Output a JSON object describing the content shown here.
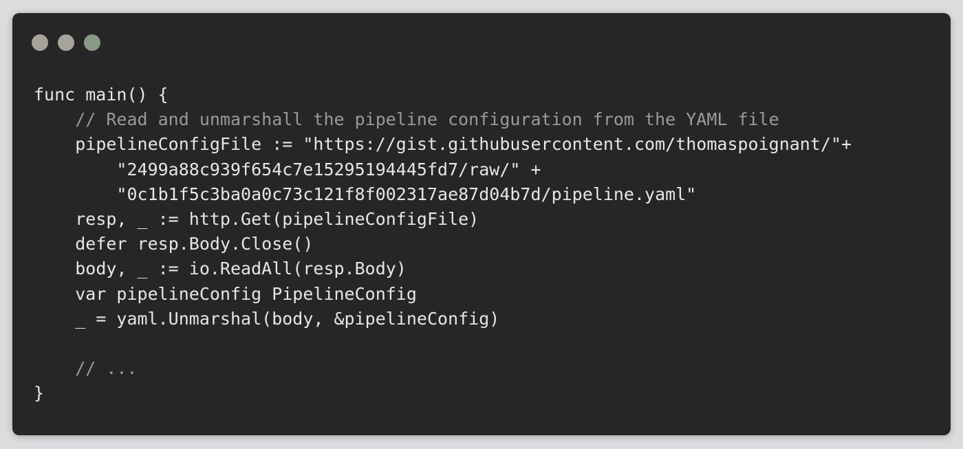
{
  "window": {
    "controls": [
      {
        "name": "close",
        "color": "#a8a29d"
      },
      {
        "name": "minimize",
        "color": "#a8a29d"
      },
      {
        "name": "zoom",
        "color": "#8a9a86"
      }
    ]
  },
  "code": {
    "language": "go",
    "lines": [
      {
        "indent": "",
        "segments": [
          {
            "type": "plain",
            "text": "func main() {"
          }
        ]
      },
      {
        "indent": "    ",
        "segments": [
          {
            "type": "comment",
            "text": "// Read and unmarshall the pipeline configuration from the YAML file"
          }
        ]
      },
      {
        "indent": "    ",
        "segments": [
          {
            "type": "plain",
            "text": "pipelineConfigFile := \"https://gist.githubusercontent.com/thomaspoignant/\"+"
          }
        ]
      },
      {
        "indent": "        ",
        "segments": [
          {
            "type": "plain",
            "text": "\"2499a88c939f654c7e15295194445fd7/raw/\" +"
          }
        ]
      },
      {
        "indent": "        ",
        "segments": [
          {
            "type": "plain",
            "text": "\"0c1b1f5c3ba0a0c73c121f8f002317ae87d04b7d/pipeline.yaml\""
          }
        ]
      },
      {
        "indent": "    ",
        "segments": [
          {
            "type": "plain",
            "text": "resp, _ := http.Get(pipelineConfigFile)"
          }
        ]
      },
      {
        "indent": "    ",
        "segments": [
          {
            "type": "keyword",
            "text": "defer"
          },
          {
            "type": "plain",
            "text": " resp.Body.Close()"
          }
        ]
      },
      {
        "indent": "    ",
        "segments": [
          {
            "type": "plain",
            "text": "body, _ := io.ReadAll(resp.Body)"
          }
        ]
      },
      {
        "indent": "    ",
        "segments": [
          {
            "type": "keyword",
            "text": "var"
          },
          {
            "type": "plain",
            "text": " pipelineConfig PipelineConfig"
          }
        ]
      },
      {
        "indent": "    ",
        "segments": [
          {
            "type": "plain",
            "text": "_ = yaml.Unmarshal(body, &pipelineConfig)"
          }
        ]
      },
      {
        "indent": "",
        "segments": [
          {
            "type": "plain",
            "text": ""
          }
        ]
      },
      {
        "indent": "    ",
        "segments": [
          {
            "type": "comment",
            "text": "// ..."
          }
        ]
      },
      {
        "indent": "",
        "segments": [
          {
            "type": "plain",
            "text": "}"
          }
        ]
      }
    ]
  }
}
